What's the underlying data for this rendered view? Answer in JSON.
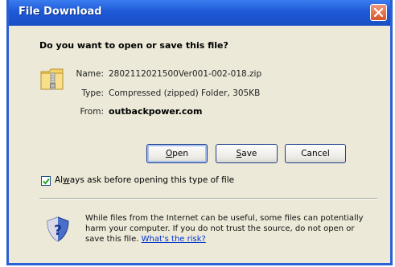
{
  "window": {
    "title": "File Download",
    "close_label": "Close"
  },
  "dialog": {
    "question": "Do you want to open or save this file?",
    "file": {
      "name_label": "Name:",
      "name_value": "2802112021500Ver001-002-018.zip",
      "type_label": "Type:",
      "type_value": "Compressed (zipped) Folder, 305KB",
      "from_label": "From:",
      "from_value": "outbackpower.com"
    },
    "buttons": {
      "open_pre": "",
      "open_key": "O",
      "open_post": "pen",
      "save_pre": "",
      "save_key": "S",
      "save_post": "ave",
      "cancel": "Cancel"
    },
    "checkbox": {
      "checked": true,
      "label_pre": "Al",
      "label_key": "w",
      "label_post": "ays ask before opening this type of file"
    },
    "warning": {
      "text": "While files from the Internet can be useful, some files can potentially harm your computer. If you do not trust the source, do not open or save this file.",
      "link": "What's the risk?"
    }
  },
  "icons": {
    "file": "zip-folder-icon",
    "shield": "security-shield-icon",
    "close": "close-icon",
    "check": "checkmark-icon"
  }
}
